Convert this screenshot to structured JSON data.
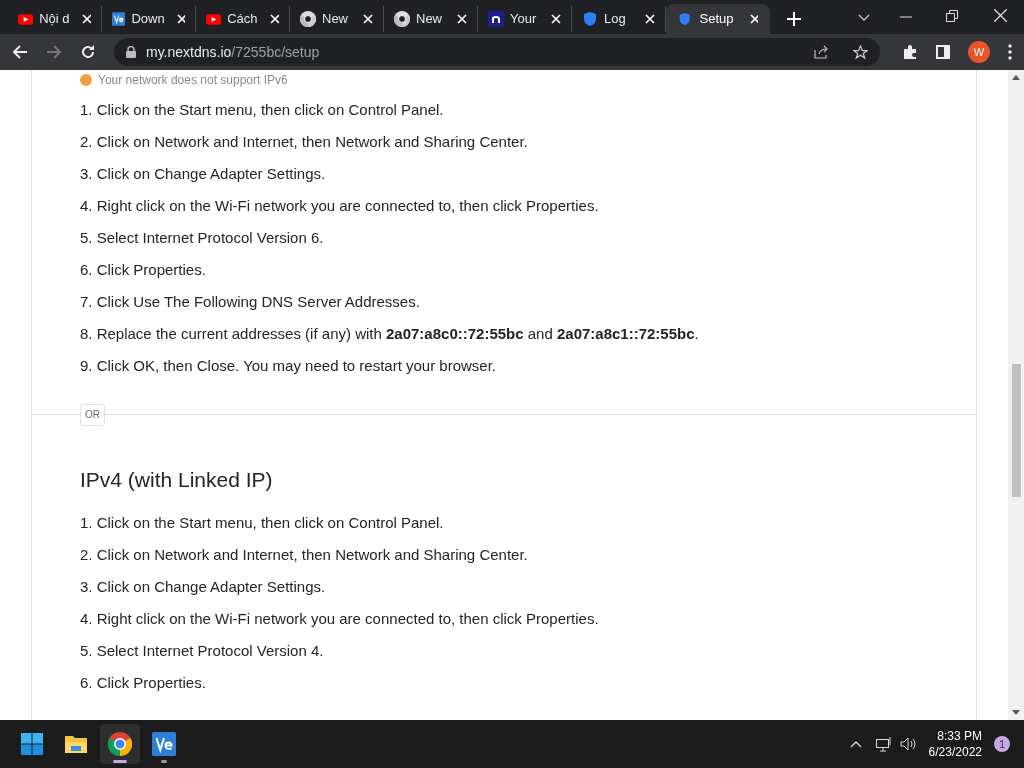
{
  "tabs": [
    {
      "title": "Nội d",
      "kind": "youtube",
      "selected": false
    },
    {
      "title": "Down",
      "kind": "ve",
      "selected": false
    },
    {
      "title": "Cách",
      "kind": "youtube",
      "selected": false
    },
    {
      "title": "New",
      "kind": "chrome",
      "selected": false
    },
    {
      "title": "New",
      "kind": "chrome",
      "selected": false
    },
    {
      "title": "Your",
      "kind": "n",
      "selected": false
    },
    {
      "title": "Log",
      "kind": "shield",
      "selected": false
    },
    {
      "title": "Setup",
      "kind": "shield",
      "selected": true
    }
  ],
  "address": {
    "host": "my.nextdns.io",
    "path": "/7255bc/setup"
  },
  "profile_initial": "W",
  "notice": "Your network does not support IPv6",
  "ipv6_steps": [
    "1. Click on the Start menu, then click on Control Panel.",
    "2. Click on Network and Internet, then Network and Sharing Center.",
    "3. Click on Change Adapter Settings.",
    "4. Right click on the Wi-Fi network you are connected to, then click Properties.",
    "5. Select Internet Protocol Version 6.",
    "6. Click Properties.",
    "7. Click Use The Following DNS Server Addresses.",
    "8. Replace the current addresses (if any) with **2a07:a8c0::72:55bc** and **2a07:a8c1::72:55bc**.",
    "9. Click OK, then Close. You may need to restart your browser."
  ],
  "separator": "OR",
  "ipv4": {
    "heading": "IPv4 (with Linked IP)",
    "steps": [
      "1. Click on the Start menu, then click on Control Panel.",
      "2. Click on Network and Internet, then Network and Sharing Center.",
      "3. Click on Change Adapter Settings.",
      "4. Right click on the Wi-Fi network you are connected to, then click Properties.",
      "5. Select Internet Protocol Version 4.",
      "6. Click Properties."
    ]
  },
  "taskbar": {
    "apps": [
      {
        "kind": "start",
        "selected": false
      },
      {
        "kind": "folder",
        "selected": false
      },
      {
        "kind": "chrome",
        "selected": true
      },
      {
        "kind": "ve",
        "selected": false
      }
    ],
    "time": "8:33 PM",
    "date": "6/23/2022",
    "notifications": "1"
  }
}
